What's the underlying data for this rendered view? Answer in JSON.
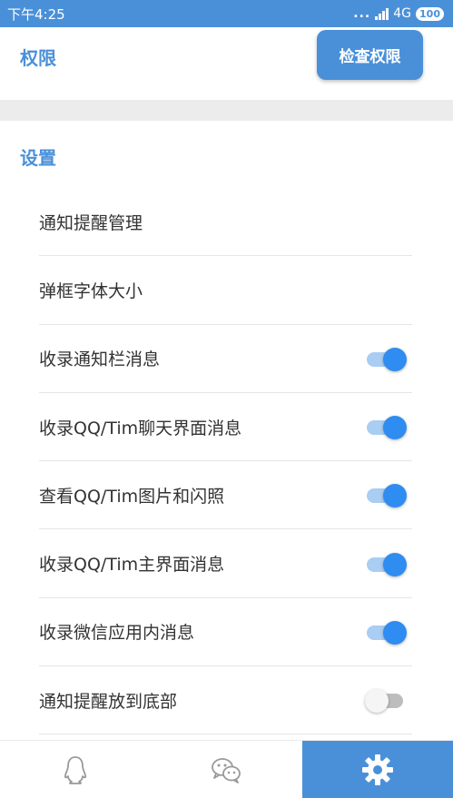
{
  "status_bar": {
    "time": "下午4:25",
    "dots": "...",
    "network": "4G",
    "battery": "100"
  },
  "permissions": {
    "title": "权限",
    "check_button": "检查权限"
  },
  "settings": {
    "title": "设置",
    "items": [
      {
        "label": "通知提醒管理"
      },
      {
        "label": "弹框字体大小"
      },
      {
        "label": "收录通知栏消息",
        "toggle": true
      },
      {
        "label": "收录QQ/Tim聊天界面消息",
        "toggle": true
      },
      {
        "label": "查看QQ/Tim图片和闪照",
        "toggle": true
      },
      {
        "label": "收录QQ/Tim主界面消息",
        "toggle": true
      },
      {
        "label": "收录微信应用内消息",
        "toggle": true
      },
      {
        "label": "通知提醒放到底部",
        "toggle": false
      }
    ]
  },
  "bottom_nav": {
    "items": [
      {
        "icon": "qq-penguin-icon",
        "active": false
      },
      {
        "icon": "wechat-icon",
        "active": false
      },
      {
        "icon": "gear-icon",
        "active": true
      }
    ]
  },
  "colors": {
    "accent": "#4a90d9",
    "toggle_on": "#2f8cf0",
    "toggle_on_track": "#a9cdf3",
    "toggle_off_track": "#bdbdbd"
  }
}
